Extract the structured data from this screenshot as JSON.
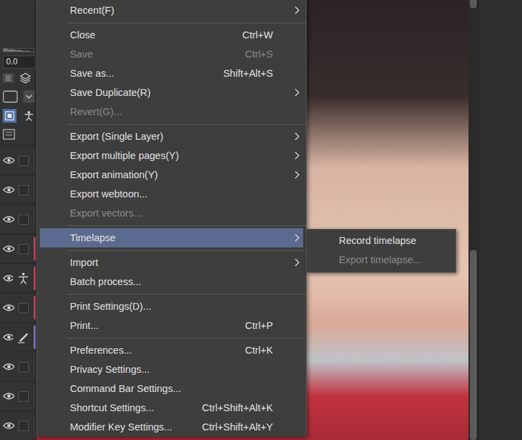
{
  "left_panel": {
    "value_field": "0.0",
    "tool_buttons": [
      {
        "selected": true
      },
      {
        "selected": false
      }
    ],
    "layers": [
      {
        "visible": true,
        "kind": "plain",
        "color": "#3a3a3a"
      },
      {
        "visible": true,
        "kind": "plain",
        "color": "#3a3a3a"
      },
      {
        "visible": true,
        "kind": "plain",
        "color": "#3a3a3a"
      },
      {
        "visible": true,
        "kind": "plain",
        "color": "#c0475a"
      },
      {
        "visible": true,
        "kind": "figure",
        "color": "#c0475a"
      },
      {
        "visible": true,
        "kind": "plain",
        "color": "#c0475a"
      },
      {
        "visible": true,
        "kind": "pen",
        "color": "#7b72c4"
      },
      {
        "visible": true,
        "kind": "plain",
        "color": "#3a3a3a"
      },
      {
        "visible": true,
        "kind": "plain",
        "color": "#3a3a3a"
      },
      {
        "visible": true,
        "kind": "plain",
        "color": "#3a3a3a"
      }
    ]
  },
  "menu": {
    "items": [
      {
        "kind": "item",
        "label": "Recent(F)",
        "shortcut": "",
        "submenu": true,
        "disabled": false,
        "selected": false
      },
      {
        "kind": "separator"
      },
      {
        "kind": "item",
        "label": "Close",
        "shortcut": "Ctrl+W",
        "submenu": false,
        "disabled": false,
        "selected": false
      },
      {
        "kind": "item",
        "label": "Save",
        "shortcut": "Ctrl+S",
        "submenu": false,
        "disabled": true,
        "selected": false
      },
      {
        "kind": "item",
        "label": "Save as...",
        "shortcut": "Shift+Alt+S",
        "submenu": false,
        "disabled": false,
        "selected": false
      },
      {
        "kind": "item",
        "label": "Save Duplicate(R)",
        "shortcut": "",
        "submenu": true,
        "disabled": false,
        "selected": false
      },
      {
        "kind": "item",
        "label": "Revert(G)...",
        "shortcut": "",
        "submenu": false,
        "disabled": true,
        "selected": false
      },
      {
        "kind": "separator"
      },
      {
        "kind": "item",
        "label": "Export (Single Layer)",
        "shortcut": "",
        "submenu": true,
        "disabled": false,
        "selected": false
      },
      {
        "kind": "item",
        "label": "Export multiple pages(Y)",
        "shortcut": "",
        "submenu": true,
        "disabled": false,
        "selected": false
      },
      {
        "kind": "item",
        "label": "Export animation(Y)",
        "shortcut": "",
        "submenu": true,
        "disabled": false,
        "selected": false
      },
      {
        "kind": "item",
        "label": "Export webtoon...",
        "shortcut": "",
        "submenu": false,
        "disabled": false,
        "selected": false
      },
      {
        "kind": "item",
        "label": "Export vectors...",
        "shortcut": "",
        "submenu": false,
        "disabled": true,
        "selected": false
      },
      {
        "kind": "separator"
      },
      {
        "kind": "item",
        "label": "Timelapse",
        "shortcut": "",
        "submenu": true,
        "disabled": false,
        "selected": true
      },
      {
        "kind": "separator"
      },
      {
        "kind": "item",
        "label": "Import",
        "shortcut": "",
        "submenu": true,
        "disabled": false,
        "selected": false
      },
      {
        "kind": "item",
        "label": "Batch process...",
        "shortcut": "",
        "submenu": false,
        "disabled": false,
        "selected": false
      },
      {
        "kind": "separator"
      },
      {
        "kind": "item",
        "label": "Print Settings(D)...",
        "shortcut": "",
        "submenu": false,
        "disabled": false,
        "selected": false
      },
      {
        "kind": "item",
        "label": "Print...",
        "shortcut": "Ctrl+P",
        "submenu": false,
        "disabled": false,
        "selected": false
      },
      {
        "kind": "separator"
      },
      {
        "kind": "item",
        "label": "Preferences...",
        "shortcut": "Ctrl+K",
        "submenu": false,
        "disabled": false,
        "selected": false
      },
      {
        "kind": "item",
        "label": "Privacy Settings...",
        "shortcut": "",
        "submenu": false,
        "disabled": false,
        "selected": false
      },
      {
        "kind": "item",
        "label": "Command Bar Settings...",
        "shortcut": "",
        "submenu": false,
        "disabled": false,
        "selected": false
      },
      {
        "kind": "item",
        "label": "Shortcut Settings...",
        "shortcut": "Ctrl+Shift+Alt+K",
        "submenu": false,
        "disabled": false,
        "selected": false
      },
      {
        "kind": "item",
        "label": "Modifier Key Settings...",
        "shortcut": "Ctrl+Shift+Alt+Y",
        "submenu": false,
        "disabled": false,
        "selected": false
      }
    ]
  },
  "submenu": {
    "items": [
      {
        "label": "Record timelapse",
        "disabled": false,
        "selected": false
      },
      {
        "label": "Export timelapse...",
        "disabled": true,
        "selected": false
      }
    ]
  }
}
